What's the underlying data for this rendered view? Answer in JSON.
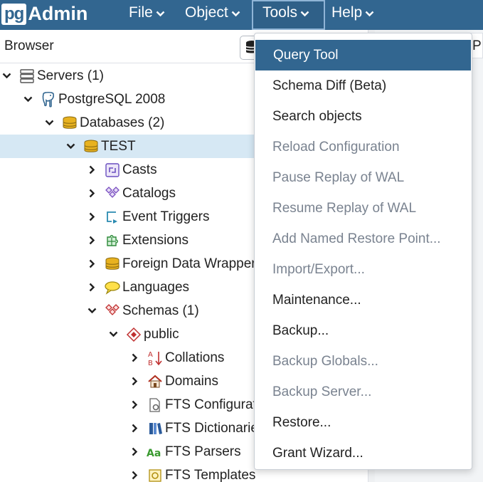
{
  "app": {
    "logo_pg": "pg",
    "logo_admin": "Admin"
  },
  "navbar": {
    "items": [
      {
        "label": "File",
        "active": false
      },
      {
        "label": "Object",
        "active": false
      },
      {
        "label": "Tools",
        "active": true
      },
      {
        "label": "Help",
        "active": false
      }
    ]
  },
  "browser": {
    "title": "Browser",
    "tree": [
      {
        "label": "Servers (1)",
        "icon": "servers-icon",
        "expanded": true,
        "selected": false
      },
      {
        "label": "PostgreSQL 2008",
        "icon": "postgresql-elephant-icon",
        "expanded": true,
        "selected": false
      },
      {
        "label": "Databases (2)",
        "icon": "databases-icon",
        "expanded": true,
        "selected": false
      },
      {
        "label": "TEST",
        "icon": "database-icon",
        "expanded": true,
        "selected": true
      },
      {
        "label": "Casts",
        "icon": "casts-icon",
        "expanded": false,
        "selected": false
      },
      {
        "label": "Catalogs",
        "icon": "catalogs-icon",
        "expanded": false,
        "selected": false
      },
      {
        "label": "Event Triggers",
        "icon": "event-triggers-icon",
        "expanded": false,
        "selected": false
      },
      {
        "label": "Extensions",
        "icon": "extensions-icon",
        "expanded": false,
        "selected": false
      },
      {
        "label": "Foreign Data Wrappers",
        "icon": "foreign-data-wrappers-icon",
        "expanded": false,
        "selected": false
      },
      {
        "label": "Languages",
        "icon": "languages-icon",
        "expanded": false,
        "selected": false
      },
      {
        "label": "Schemas (1)",
        "icon": "schemas-icon",
        "expanded": true,
        "selected": false
      },
      {
        "label": "public",
        "icon": "schema-icon",
        "expanded": true,
        "selected": false
      },
      {
        "label": "Collations",
        "icon": "collations-icon",
        "expanded": false,
        "selected": false
      },
      {
        "label": "Domains",
        "icon": "domains-icon",
        "expanded": false,
        "selected": false
      },
      {
        "label": "FTS Configurations",
        "icon": "fts-configurations-icon",
        "expanded": false,
        "selected": false
      },
      {
        "label": "FTS Dictionaries",
        "icon": "fts-dictionaries-icon",
        "expanded": false,
        "selected": false
      },
      {
        "label": "FTS Parsers",
        "icon": "fts-parsers-icon",
        "expanded": false,
        "selected": false
      },
      {
        "label": "FTS Templates",
        "icon": "fts-templates-icon",
        "expanded": false,
        "selected": false
      }
    ]
  },
  "tools_menu": {
    "items": [
      {
        "label": "Query Tool",
        "enabled": true,
        "highlighted": true
      },
      {
        "label": "Schema Diff (Beta)",
        "enabled": true,
        "highlighted": false
      },
      {
        "label": "Search objects",
        "enabled": true,
        "highlighted": false
      },
      {
        "label": "Reload Configuration",
        "enabled": false,
        "highlighted": false
      },
      {
        "label": "Pause Replay of WAL",
        "enabled": false,
        "highlighted": false
      },
      {
        "label": "Resume Replay of WAL",
        "enabled": false,
        "highlighted": false
      },
      {
        "label": "Add Named Restore Point...",
        "enabled": false,
        "highlighted": false
      },
      {
        "label": "Import/Export...",
        "enabled": false,
        "highlighted": false
      },
      {
        "label": "Maintenance...",
        "enabled": true,
        "highlighted": false
      },
      {
        "label": "Backup...",
        "enabled": true,
        "highlighted": false
      },
      {
        "label": "Backup Globals...",
        "enabled": false,
        "highlighted": false
      },
      {
        "label": "Backup Server...",
        "enabled": false,
        "highlighted": false
      },
      {
        "label": "Restore...",
        "enabled": true,
        "highlighted": false
      },
      {
        "label": "Grant Wizard...",
        "enabled": true,
        "highlighted": false
      }
    ]
  },
  "right_panel": {
    "tab_label": "P"
  },
  "colors": {
    "navbar": "#326690",
    "selected_row": "#d6e8f4",
    "menu_highlight": "#326690",
    "disabled_text": "#7a8390"
  }
}
